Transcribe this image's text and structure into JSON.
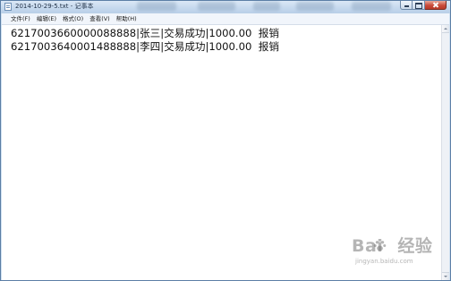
{
  "window": {
    "title": "2014-10-29-5.txt - 记事本"
  },
  "menu": {
    "items": [
      {
        "label": "文件(F)"
      },
      {
        "label": "编辑(E)"
      },
      {
        "label": "格式(O)"
      },
      {
        "label": "查看(V)"
      },
      {
        "label": "帮助(H)"
      }
    ]
  },
  "document": {
    "lines": [
      "6217003660000088888|张三|交易成功|1000.00  报销",
      "6217003640001488888|李四|交易成功|1000.00  报销"
    ]
  },
  "watermark": {
    "logo_left": "Bai",
    "logo_right": "经验",
    "url": "jingyan.baidu.com"
  },
  "colors": {
    "titlebar": "#c6d9ee",
    "close_button": "#c94b3a",
    "menubar": "#f1f5fb"
  },
  "icons": {
    "app": "notepad-icon",
    "minimize": "minimize-icon",
    "maximize": "maximize-icon",
    "close": "close-icon",
    "paw": "paw-icon"
  }
}
